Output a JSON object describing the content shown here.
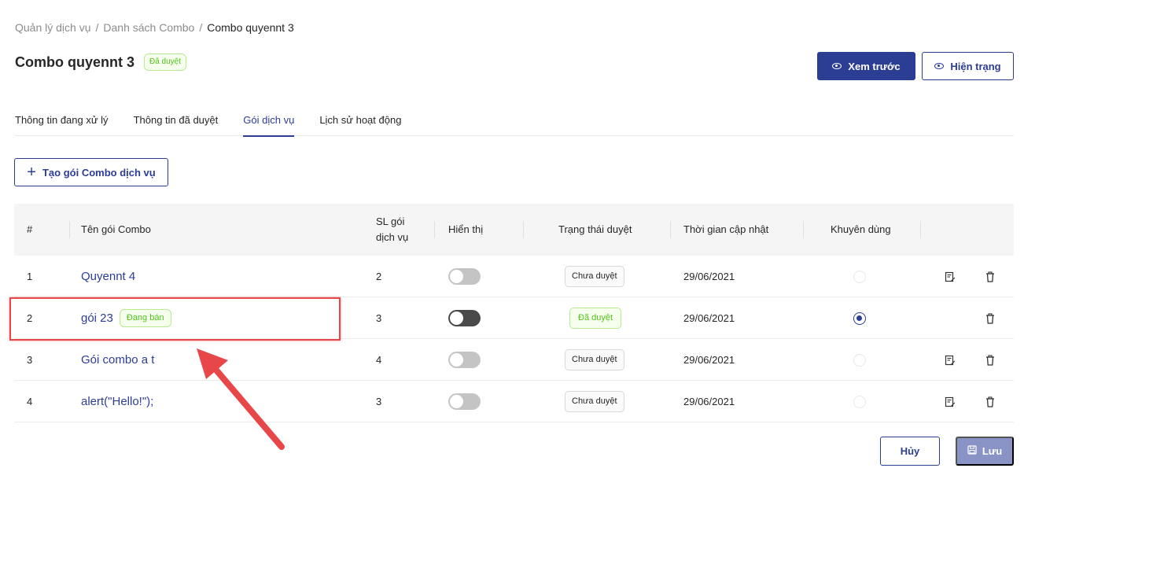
{
  "breadcrumb": {
    "items": [
      "Quản lý dịch vụ",
      "Danh sách Combo"
    ],
    "current": "Combo quyennt 3",
    "separator": "/"
  },
  "page": {
    "title": "Combo quyennt 3",
    "status_badge": "Đã duyệt"
  },
  "header_actions": {
    "preview_label": "Xem trước",
    "current_state_label": "Hiện trạng"
  },
  "tabs": [
    {
      "label": "Thông tin đang xử lý",
      "active": false
    },
    {
      "label": "Thông tin đã duyệt",
      "active": false
    },
    {
      "label": "Gói dịch vụ",
      "active": true
    },
    {
      "label": "Lịch sử hoạt động",
      "active": false
    }
  ],
  "create_button_label": "Tạo gói Combo dịch vụ",
  "table": {
    "headers": {
      "index": "#",
      "name": "Tên gói Combo",
      "count_line1": "SL gói",
      "count_line2": "dịch vụ",
      "display": "Hiển thị",
      "approval": "Trạng thái duyệt",
      "updated": "Thời gian cập nhật",
      "recommended": "Khuyên dùng"
    },
    "rows": [
      {
        "index": "1",
        "name": "Quyennt 4",
        "tag": "",
        "count": "2",
        "display_on": false,
        "approval": "Chưa duyệt",
        "approved": false,
        "updated": "29/06/2021",
        "recommended": false,
        "editable": true
      },
      {
        "index": "2",
        "name": "gói 23",
        "tag": "Đang bán",
        "count": "3",
        "display_on": true,
        "approval": "Đã duyệt",
        "approved": true,
        "updated": "29/06/2021",
        "recommended": true,
        "editable": false
      },
      {
        "index": "3",
        "name": "Gói combo a t",
        "tag": "",
        "count": "4",
        "display_on": false,
        "approval": "Chưa duyệt",
        "approved": false,
        "updated": "29/06/2021",
        "recommended": false,
        "editable": true
      },
      {
        "index": "4",
        "name": "alert(\"Hello!\");",
        "tag": "",
        "count": "3",
        "display_on": false,
        "approval": "Chưa duyệt",
        "approved": false,
        "updated": "29/06/2021",
        "recommended": false,
        "editable": true
      }
    ]
  },
  "footer_actions": {
    "cancel_label": "Hủy",
    "save_label": "Lưu"
  },
  "colors": {
    "primary": "#2c3d94",
    "success": "#52c41a",
    "annotation": "#e8474a"
  }
}
